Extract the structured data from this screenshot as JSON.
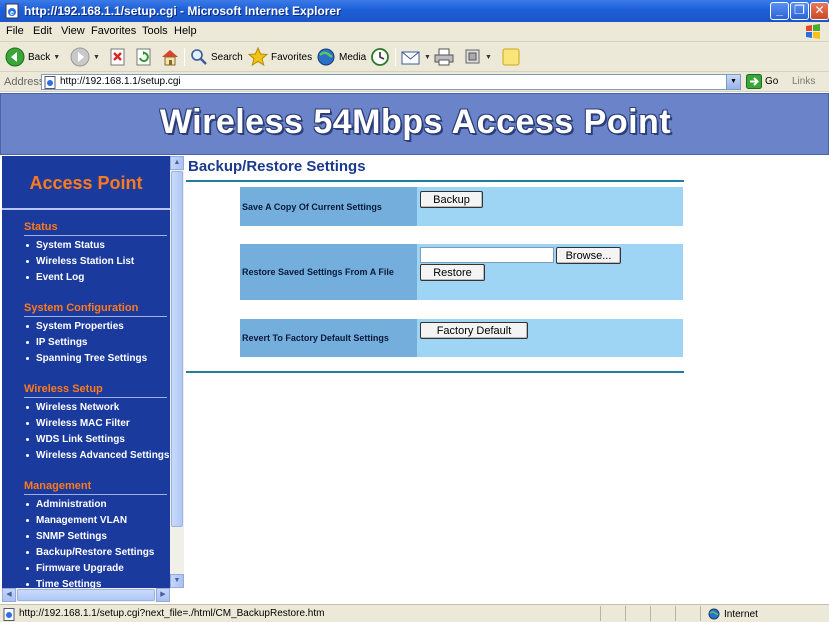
{
  "window": {
    "title": "http://192.168.1.1/setup.cgi - Microsoft Internet Explorer",
    "controls": {
      "minimize": "_",
      "maximize": "❐",
      "close": "✕"
    }
  },
  "menubar": {
    "items": [
      "File",
      "Edit",
      "View",
      "Favorites",
      "Tools",
      "Help"
    ]
  },
  "toolbar": {
    "back_label": "Back",
    "search_label": "Search",
    "favorites_label": "Favorites",
    "media_label": "Media"
  },
  "address": {
    "label": "Address",
    "url": "http://192.168.1.1/setup.cgi",
    "go_label": "Go",
    "links_label": "Links"
  },
  "banner": {
    "title": "Wireless 54Mbps Access Point"
  },
  "sidebar": {
    "heading": "Access Point",
    "sections": [
      {
        "title": "Status",
        "items": [
          "System Status",
          "Wireless Station List",
          "Event Log"
        ]
      },
      {
        "title": "System Configuration",
        "items": [
          "System Properties",
          "IP Settings",
          "Spanning Tree Settings"
        ]
      },
      {
        "title": "Wireless Setup",
        "items": [
          "Wireless Network",
          "Wireless MAC Filter",
          "WDS Link Settings",
          "Wireless Advanced Settings"
        ]
      },
      {
        "title": "Management",
        "items": [
          "Administration",
          "Management VLAN",
          "SNMP Settings",
          "Backup/Restore Settings",
          "Firmware Upgrade",
          "Time Settings"
        ]
      }
    ]
  },
  "main": {
    "heading": "Backup/Restore Settings",
    "rows": [
      {
        "label": "Save A Copy Of Current Settings",
        "button": "Backup"
      },
      {
        "label": "Restore Saved Settings From A File",
        "browse_button": "Browse...",
        "file_value": "",
        "button": "Restore"
      },
      {
        "label": "Revert To Factory Default Settings",
        "button": "Factory Default"
      }
    ]
  },
  "statusbar": {
    "text": "http://192.168.1.1/setup.cgi?next_file=./html/CM_BackupRestore.htm",
    "zone": "Internet"
  },
  "colors": {
    "titlebar": "#1d5fd6",
    "banner": "#6b83c8",
    "sidebar": "#1a3a9e",
    "accent_orange": "#ff7a1a",
    "row_label": "#74aedc",
    "row_value": "#9ed4f4",
    "rule": "#1f7f99"
  }
}
